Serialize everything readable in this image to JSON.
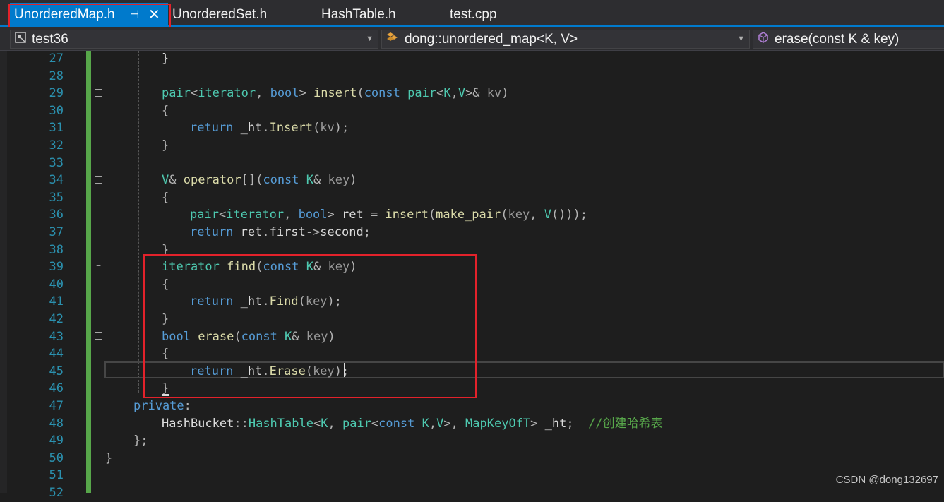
{
  "tabs": [
    {
      "label": "UnorderedMap.h",
      "pin": "⊣",
      "close": "✕"
    },
    {
      "label": "UnorderedSet.h"
    },
    {
      "label": "HashTable.h"
    },
    {
      "label": "test.cpp"
    }
  ],
  "nav": {
    "project": "test36",
    "scope": "dong::unordered_map<K, V>",
    "member": "erase(const K & key)"
  },
  "line_numbers": [
    "27",
    "28",
    "29",
    "30",
    "31",
    "32",
    "33",
    "34",
    "35",
    "36",
    "37",
    "38",
    "39",
    "40",
    "41",
    "42",
    "43",
    "44",
    "45",
    "46",
    "47",
    "48",
    "49",
    "50",
    "51",
    "52"
  ],
  "code": {
    "l27_brace": "}",
    "l29": {
      "a": "pair",
      "b": "<",
      "c": "iterator",
      ",": ", ",
      "d": "bool",
      "e": ">",
      "f": " insert",
      "g": "(",
      "h": "const",
      "i": " pair",
      "j": "<",
      "k": "K",
      "l": ",",
      "m": "V",
      "n": ">&",
      "o": " kv",
      ")": ")"
    },
    "l30": "{",
    "l31": {
      "ret": "return",
      "a": " _ht",
      "b": ".",
      "c": "Insert",
      "d": "(",
      "e": "kv",
      "f": ");"
    },
    "l32": "}",
    "l34": {
      "a": "V",
      "b": "& ",
      "c": "operator",
      "d": "[](",
      "e": "const",
      "f": " K",
      "g": "&",
      "h": " key",
      ")": ")"
    },
    "l35": "{",
    "l36": {
      "a": "pair",
      "b": "<",
      "c": "iterator",
      ",": ", ",
      "d": "bool",
      "e": ">",
      "f": " ret",
      "g": " = ",
      "h": "insert",
      "i": "(",
      "j": "make_pair",
      "k": "(",
      "l": "key",
      "m": "V",
      "n": "()));"
    },
    "l37": {
      "ret": "return",
      "a": " ret",
      "b": ".",
      "c": "first",
      "d": "->",
      "e": "second",
      "f": ";"
    },
    "l38": "}",
    "l39": {
      "a": "iterator",
      "b": " find",
      "c": "(",
      "d": "const",
      "e": " K",
      "f": "&",
      "g": " key",
      ")": ")"
    },
    "l40": "{",
    "l41": {
      "ret": "return",
      "a": " _ht",
      "b": ".",
      "c": "Find",
      "d": "(",
      "e": "key",
      "f": ");"
    },
    "l42": "}",
    "l43": {
      "a": "bool",
      "b": " erase",
      "c": "(",
      "d": "const",
      "e": " K",
      "f": "&",
      "g": " key",
      ")": ")"
    },
    "l44": "{",
    "l45": {
      "ret": "return",
      "a": " _ht",
      "b": ".",
      "c": "Erase",
      "d": "(",
      "e": "key",
      "f": ");"
    },
    "l46": "}",
    "l47": {
      "a": "private",
      "b": ":"
    },
    "l48": {
      "a": "HashBucket",
      "b": "::",
      "c": "HashTable",
      "d": "<",
      "e": "K",
      ",": ", ",
      "f": "pair",
      "g": "<",
      "h": "const",
      "i": " K",
      "j": ",",
      "k": "V",
      "l": ">, ",
      "m": "MapKeyOfT",
      "n": ">",
      "o": " _ht",
      "p": ";",
      "q": "  //创建哈希表"
    },
    "l49": "};",
    "l50": "}"
  },
  "watermark": "CSDN @dong132697",
  "colors": {
    "accent": "#007acc",
    "highlight_box": "#e3222b",
    "keyword": "#569cd6",
    "type": "#4ec9b0",
    "function": "#dcdcaa",
    "param": "#9a9a9a",
    "comment": "#57a64a",
    "line_number": "#2b91af"
  }
}
